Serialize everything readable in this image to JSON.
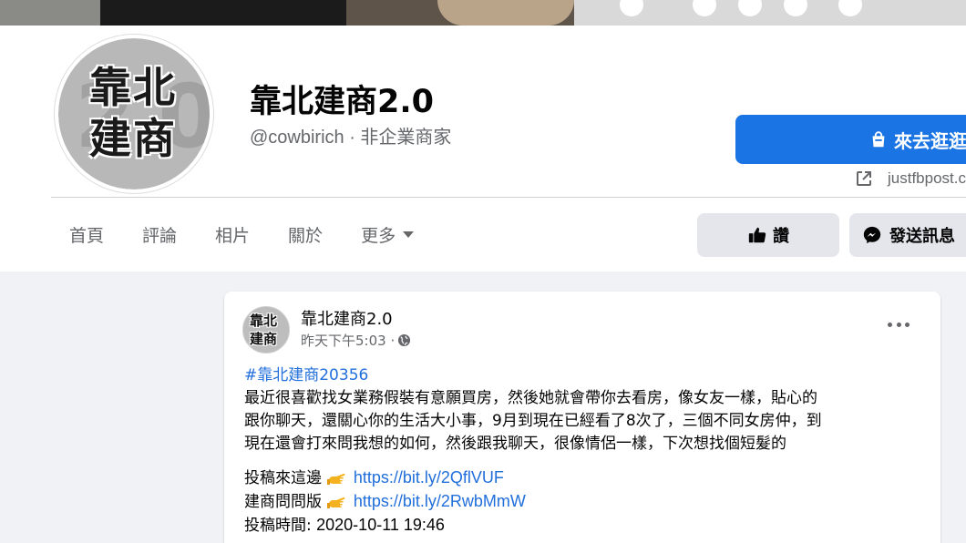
{
  "page": {
    "name": "靠北建商2.0",
    "handle_line": "@cowbirich · 非企業商家",
    "avatar_text_line1": "靠北",
    "avatar_text_line2": "建商",
    "avatar_bg_text": "2.0"
  },
  "actions": {
    "shop_label": "來去逛逛",
    "shop_link": "justfbpost.c",
    "like_label": "讚",
    "message_label": "發送訊息"
  },
  "tabs": [
    {
      "label": "首頁"
    },
    {
      "label": "評論"
    },
    {
      "label": "相片"
    },
    {
      "label": "關於"
    },
    {
      "label": "更多"
    }
  ],
  "post": {
    "author": "靠北建商2.0",
    "time": "昨天下午5:03 ·",
    "avatar_line1": "靠北",
    "avatar_line2": "建商",
    "hashtag": "#靠北建商20356",
    "lines": [
      "最近很喜歡找女業務假裝有意願買房，然後她就會帶你去看房，像女友一樣，貼心的",
      "跟你聊天，還關心你的生活大小事，9月到現在已經看了8次了，三個不同女房仲，到",
      "現在還會打來問我想的如何，然後跟我聊天，很像情侶一樣，下次想找個短髮的"
    ],
    "submit_label": "投稿來這邊",
    "submit_url": "https://bit.ly/2QflVUF",
    "ask_label": "建商問問版",
    "ask_url": "https://bit.ly/2RwbMmW",
    "submit_time_label": "投稿時間:",
    "submit_time": "2020-10-11 19:46"
  },
  "colors": {
    "accent": "#1b74e4",
    "link": "#216fdb",
    "secondary_text": "#65676b",
    "page_bg": "#f0f2f5"
  },
  "icons": {
    "shop": "shopping-bag-icon",
    "external": "external-link-icon",
    "like": "thumbs-up-icon",
    "message": "messenger-icon",
    "audience": "globe-icon",
    "more": "more-dots-icon",
    "pointer": "pointing-hand-emoji"
  }
}
